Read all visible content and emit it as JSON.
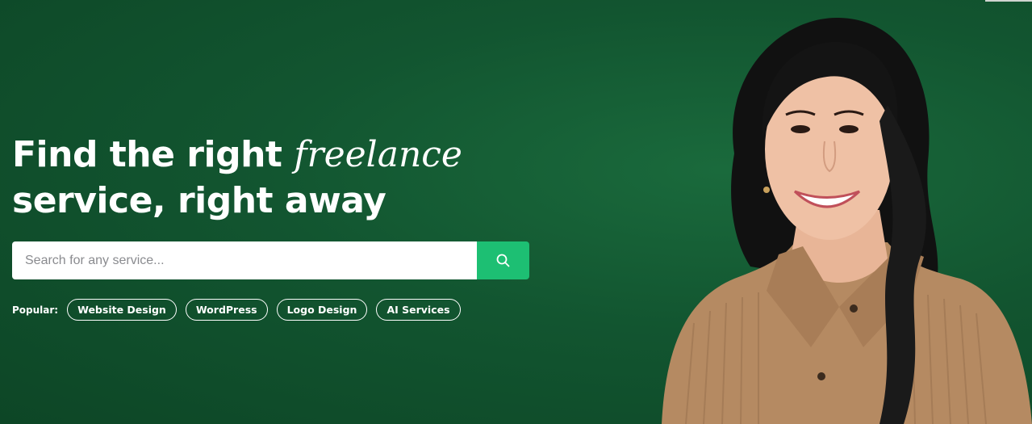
{
  "hero": {
    "headline_part1": "Find the right ",
    "headline_accent": "freelance",
    "headline_part2": "service, right away"
  },
  "search": {
    "placeholder": "Search for any service...",
    "button_icon": "search-icon"
  },
  "popular": {
    "label": "Popular:",
    "chips": [
      "Website Design",
      "WordPress",
      "Logo Design",
      "AI Services"
    ]
  },
  "colors": {
    "background": "#125530",
    "accent": "#1dbf73",
    "text": "#ffffff"
  }
}
